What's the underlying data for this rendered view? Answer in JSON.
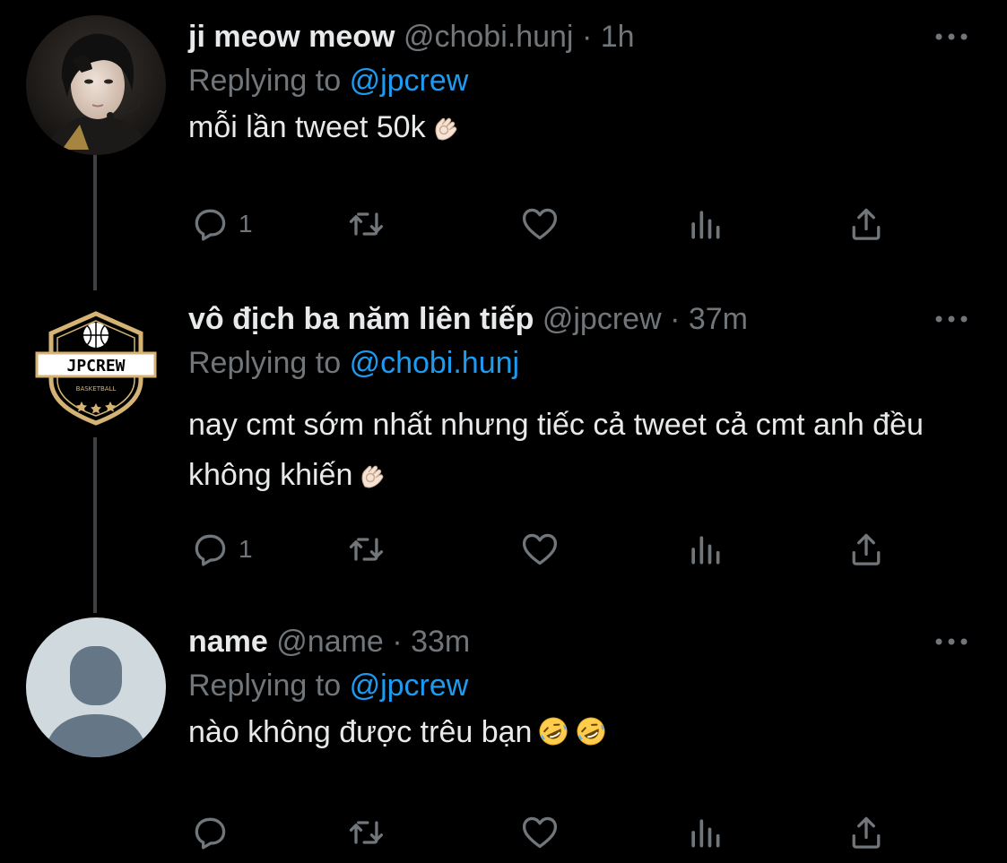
{
  "tweets": [
    {
      "display_name": "ji meow meow",
      "handle": "@chobi.hunj",
      "time": "1h",
      "replying_prefix": "Replying to",
      "replying_to": "@jpcrew",
      "text": "mỗi lần tweet 50k",
      "emoji": "ok-hand",
      "reply_count": "1",
      "avatar": "photo-avatar"
    },
    {
      "display_name": "vô địch ba năm liên tiếp",
      "handle": "@jpcrew",
      "time": "37m",
      "replying_prefix": "Replying to",
      "replying_to": "@chobi.hunj",
      "text": "nay cmt sớm nhất nhưng tiếc cả tweet cả cmt anh đều không khiến",
      "emoji": "ok-hand",
      "reply_count": "1",
      "avatar": "jpcrew-logo",
      "logo_text": "JPCREW",
      "logo_subtext": "BASKETBALL"
    },
    {
      "display_name": "name",
      "handle": "@name",
      "time": "33m",
      "replying_prefix": "Replying to",
      "replying_to": "@jpcrew",
      "text": "nào không được trêu bạn",
      "emoji": "rofl",
      "reply_count": "",
      "avatar": "default-avatar"
    }
  ],
  "separator": "·",
  "colors": {
    "background": "#000000",
    "text": "#e7e9ea",
    "muted": "#71767b",
    "link": "#1d9bf0",
    "thread_line": "#3e4144"
  },
  "icons": [
    "reply-icon",
    "retweet-icon",
    "like-icon",
    "views-icon",
    "share-icon",
    "more-icon"
  ]
}
